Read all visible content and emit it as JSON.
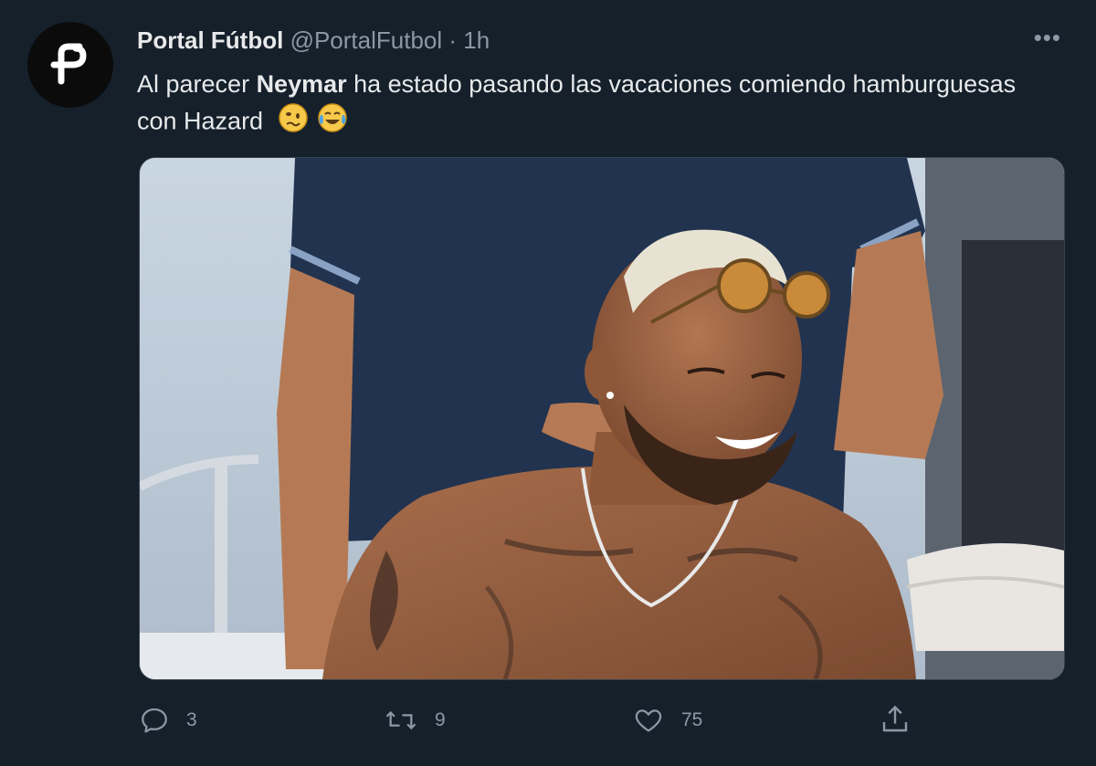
{
  "tweet": {
    "display_name": "Portal Fútbol",
    "handle": "@PortalFutbol",
    "separator": "·",
    "time": "1h",
    "more_label": "•••",
    "text_part1": "Al parecer ",
    "text_bold": "Neymar",
    "text_part2": " ha estado pasando las vacaciones comiendo hamburguesas con Hazard",
    "emojis": [
      "woozy-face-emoji",
      "tears-of-joy-emoji"
    ]
  },
  "actions": {
    "reply_count": "3",
    "retweet_count": "9",
    "like_count": "75"
  },
  "icons": {
    "avatar": "portal-futbol-logo",
    "reply": "reply-icon",
    "retweet": "retweet-icon",
    "like": "heart-icon",
    "share": "share-icon"
  },
  "colors": {
    "background": "#15202b",
    "primary_text": "#e7e9ea",
    "secondary_text": "#8b98a5"
  }
}
